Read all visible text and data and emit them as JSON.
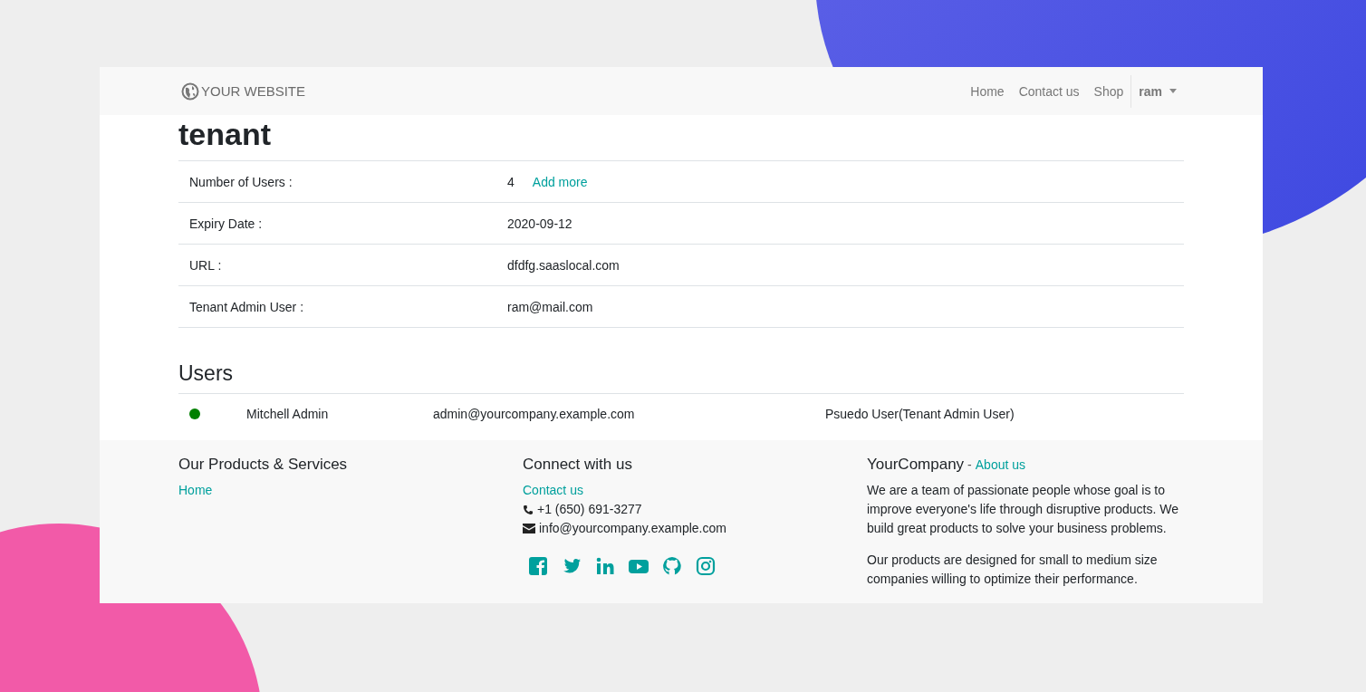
{
  "navbar": {
    "logo": "YOUR WEBSITE",
    "links": [
      "Home",
      "Contact us",
      "Shop"
    ],
    "user": "ram"
  },
  "title": "tenant",
  "details": [
    {
      "label": "Number of Users :",
      "value": "4",
      "link": "Add more"
    },
    {
      "label": "Expiry Date :",
      "value": "2020-09-12"
    },
    {
      "label": "URL :",
      "value": "dfdfg.saaslocal.com"
    },
    {
      "label": "Tenant Admin User :",
      "value": "ram@mail.com"
    }
  ],
  "users_heading": "Users",
  "users": [
    {
      "color": "#008000",
      "name": "Mitchell Admin",
      "email": "admin@yourcompany.example.com",
      "role": "Psuedo User(Tenant Admin User)"
    }
  ],
  "footer": {
    "products": {
      "heading": "Our Products & Services",
      "links": [
        "Home"
      ]
    },
    "connect": {
      "heading": "Connect with us",
      "link": "Contact us",
      "phone": "+1 (650) 691-3277",
      "email": "info@yourcompany.example.com"
    },
    "about": {
      "heading": "YourCompany",
      "separator": "-",
      "link": "About us",
      "paragraphs": [
        "We are a team of passionate people whose goal is to improve everyone's life through disruptive products. We build great products to solve your business problems.",
        "Our products are designed for small to medium size companies willing to optimize their performance."
      ]
    }
  }
}
